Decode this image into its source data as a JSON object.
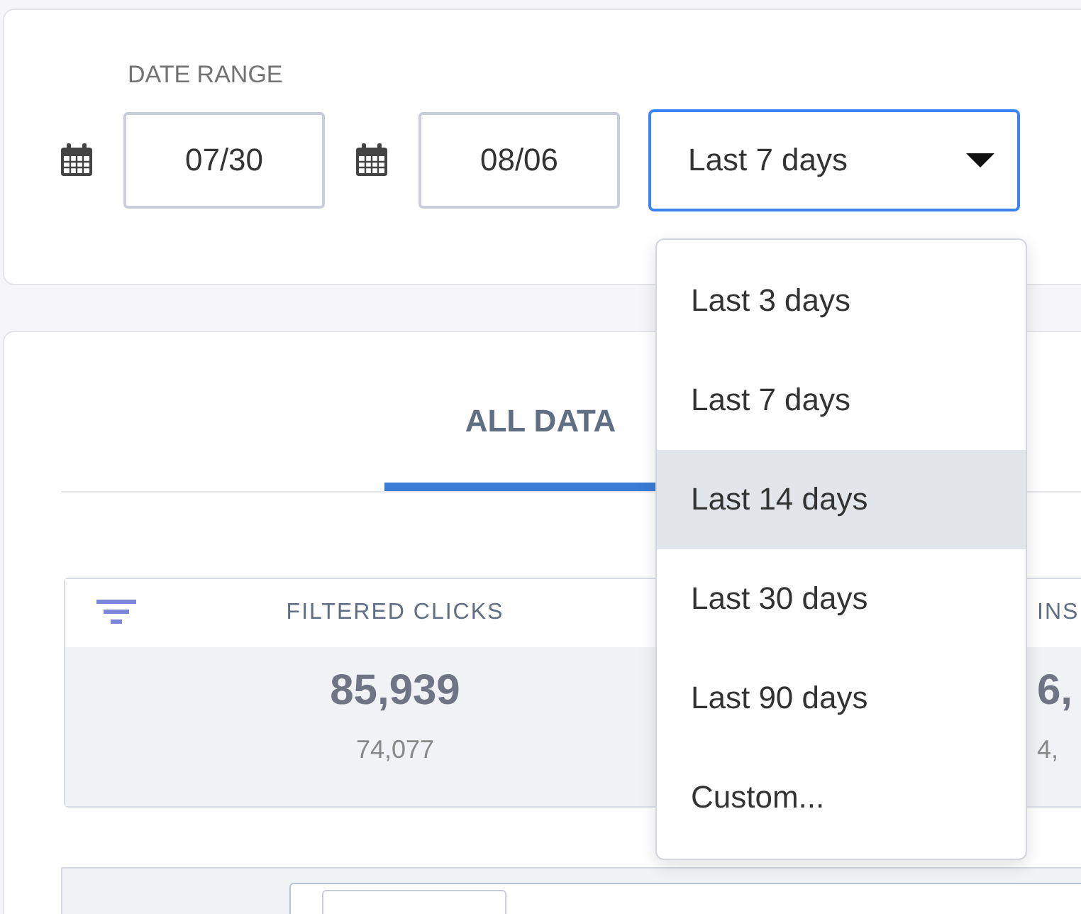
{
  "date_range": {
    "label": "DATE RANGE",
    "start": "07/30",
    "end": "08/06",
    "preset": "Last 7 days",
    "menu_open": true,
    "options": [
      {
        "label": "Last 3 days",
        "selected": false
      },
      {
        "label": "Last 7 days",
        "selected": false
      },
      {
        "label": "Last 14 days",
        "selected": true
      },
      {
        "label": "Last 30 days",
        "selected": false
      },
      {
        "label": "Last 90 days",
        "selected": false
      },
      {
        "label": "Custom...",
        "selected": false
      }
    ]
  },
  "tabs": [
    {
      "label": "ALL DATA",
      "selected": true
    }
  ],
  "stats": [
    {
      "title": "FILTERED CLICKS",
      "value": "85,939",
      "previous": "74,077"
    },
    {
      "title": "INS",
      "value": "6,",
      "previous": "4,"
    }
  ]
}
